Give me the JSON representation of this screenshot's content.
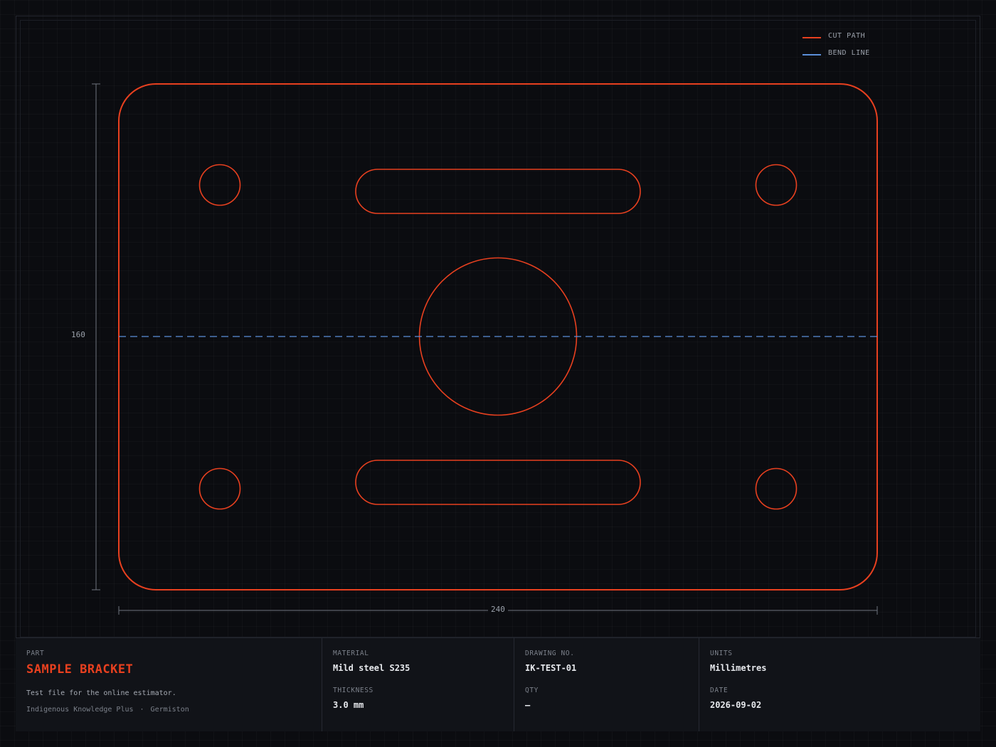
{
  "legend": {
    "cut_label": "CUT PATH",
    "bend_label": "BEND LINE",
    "cut_color": "#e8401f",
    "bend_color": "#5b8fd9"
  },
  "dimensions": {
    "width_label": "240",
    "height_label": "160",
    "width_mm": 240,
    "height_mm": 160
  },
  "title_block": {
    "part_label": "PART",
    "part_name": "SAMPLE BRACKET",
    "description": "Test file for the online estimator.",
    "company": "Indigenous Knowledge Plus",
    "separator": "·",
    "location": "Germiston",
    "material_label": "MATERIAL",
    "material_value": "Mild steel S235",
    "thickness_label": "THICKNESS",
    "thickness_value": "3.0 mm",
    "drawing_label": "DRAWING No.",
    "drawing_value": "IK-TEST-01",
    "qty_label": "QTY",
    "qty_value": "—",
    "units_label": "UNITS",
    "units_value": "Millimetres",
    "date_label": "DATE",
    "date_value": "2026-09-02"
  }
}
